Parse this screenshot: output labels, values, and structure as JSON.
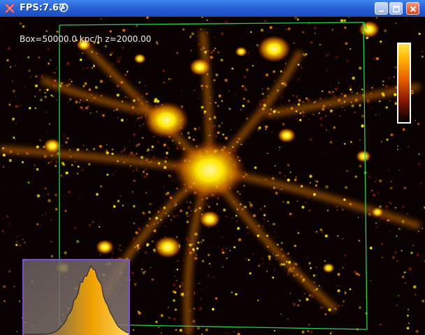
{
  "window": {
    "title": "FPS:7.67",
    "icons": {
      "app": "red-x-app-icon",
      "loading": "spinner-icon",
      "minimize": "minimize-icon",
      "maximize": "maximize-icon",
      "close": "close-icon"
    },
    "colors": {
      "titlebar": "#2a63d6",
      "close_button": "#e24d2a"
    }
  },
  "viewport": {
    "overlay_text": "Box=50000.0 kpc/h  z=2000.00",
    "colors": {
      "background": "#0a0200",
      "bright": "#ffe800",
      "mid": "#e07800",
      "dim": "#7a1800",
      "bounding_box": "#28d04a"
    }
  },
  "colorbar": {
    "colors": [
      "#ffe64a",
      "#ffb000",
      "#e76000",
      "#8a1800",
      "#000000"
    ]
  },
  "histogram": {
    "border_color": "#7a4fd8"
  }
}
